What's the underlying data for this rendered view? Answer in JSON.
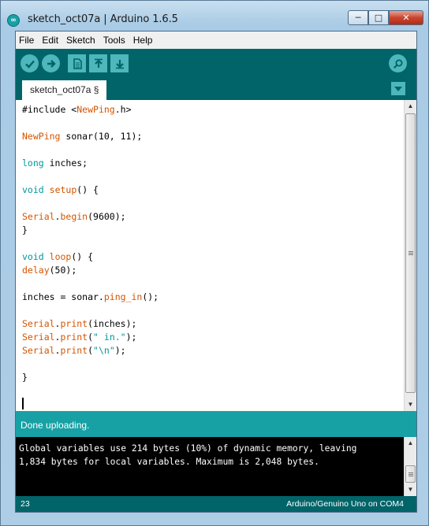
{
  "window": {
    "title": "sketch_oct07a | Arduino 1.6.5",
    "app_icon": "arduino-infinity-icon",
    "controls": {
      "minimize": "─",
      "maximize": "□",
      "close": "✕"
    }
  },
  "menubar": {
    "items": [
      "File",
      "Edit",
      "Sketch",
      "Tools",
      "Help"
    ]
  },
  "toolbar": {
    "buttons": [
      {
        "name": "verify",
        "icon": "checkmark-icon"
      },
      {
        "name": "upload",
        "icon": "arrow-right-icon"
      },
      {
        "name": "new",
        "icon": "document-icon"
      },
      {
        "name": "open",
        "icon": "arrow-up-icon"
      },
      {
        "name": "save",
        "icon": "arrow-down-icon"
      },
      {
        "name": "serial-monitor",
        "icon": "magnifier-icon"
      }
    ]
  },
  "tabs": [
    {
      "label": "sketch_oct07a §",
      "active": true
    }
  ],
  "editor": {
    "lines": [
      [
        {
          "t": "#include <",
          "c": ""
        },
        {
          "t": "NewPing",
          "c": "kw-orange"
        },
        {
          "t": ".h>",
          "c": ""
        }
      ],
      [],
      [
        {
          "t": "NewPing",
          "c": "kw-orange"
        },
        {
          "t": " sonar(10, 11);",
          "c": ""
        }
      ],
      [],
      [
        {
          "t": "long",
          "c": "kw-teal"
        },
        {
          "t": " inches;",
          "c": ""
        }
      ],
      [],
      [
        {
          "t": "void",
          "c": "kw-teal"
        },
        {
          "t": " ",
          "c": ""
        },
        {
          "t": "setup",
          "c": "kw-orange"
        },
        {
          "t": "() {",
          "c": ""
        }
      ],
      [],
      [
        {
          "t": "Serial",
          "c": "kw-orange"
        },
        {
          "t": ".",
          "c": ""
        },
        {
          "t": "begin",
          "c": "kw-orange"
        },
        {
          "t": "(9600);",
          "c": ""
        }
      ],
      [
        {
          "t": "}",
          "c": ""
        }
      ],
      [],
      [
        {
          "t": "void",
          "c": "kw-teal"
        },
        {
          "t": " ",
          "c": ""
        },
        {
          "t": "loop",
          "c": "kw-orange"
        },
        {
          "t": "() {",
          "c": ""
        }
      ],
      [
        {
          "t": "delay",
          "c": "kw-orange"
        },
        {
          "t": "(50);",
          "c": ""
        }
      ],
      [],
      [
        {
          "t": "inches = sonar.",
          "c": ""
        },
        {
          "t": "ping_in",
          "c": "kw-orange"
        },
        {
          "t": "();",
          "c": ""
        }
      ],
      [],
      [
        {
          "t": "Serial",
          "c": "kw-orange"
        },
        {
          "t": ".",
          "c": ""
        },
        {
          "t": "print",
          "c": "kw-orange"
        },
        {
          "t": "(inches);",
          "c": ""
        }
      ],
      [
        {
          "t": "Serial",
          "c": "kw-orange"
        },
        {
          "t": ".",
          "c": ""
        },
        {
          "t": "print",
          "c": "kw-orange"
        },
        {
          "t": "(",
          "c": ""
        },
        {
          "t": "\" in.\"",
          "c": "kw-teal"
        },
        {
          "t": ");",
          "c": ""
        }
      ],
      [
        {
          "t": "Serial",
          "c": "kw-orange"
        },
        {
          "t": ".",
          "c": ""
        },
        {
          "t": "print",
          "c": "kw-orange"
        },
        {
          "t": "(",
          "c": ""
        },
        {
          "t": "\"\\n\"",
          "c": "kw-teal"
        },
        {
          "t": ");",
          "c": ""
        }
      ],
      [],
      [
        {
          "t": "}",
          "c": ""
        }
      ],
      [],
      [
        {
          "t": "",
          "c": "",
          "caret": true
        }
      ]
    ]
  },
  "status": {
    "message": "Done uploading."
  },
  "console": {
    "text": "Global variables use 214 bytes (10%) of dynamic memory, leaving\n1,834 bytes for local variables. Maximum is 2,048 bytes."
  },
  "footer": {
    "line_number": "23",
    "board": "Arduino/Genuino Uno on COM4"
  },
  "colors": {
    "frame_teal": "#006468",
    "accent_teal": "#17a1a5",
    "button_teal": "#4db7bb",
    "keyword_orange": "#d35400",
    "keyword_teal": "#00979c"
  }
}
